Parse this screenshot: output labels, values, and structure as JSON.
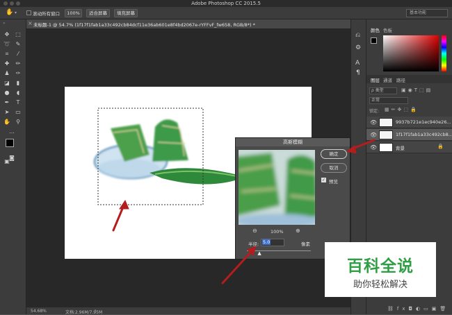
{
  "window": {
    "title": "Adobe Photoshop CC 2015.5"
  },
  "options_bar": {
    "scroll_all": "滚动所有窗口",
    "zoom_100": "100%",
    "fit_screen": "适合屏幕",
    "fill_screen": "填充屏幕",
    "workspace": "基本功能"
  },
  "document": {
    "tab_title": "未标题-1 @ 54.7% (1f17f1fab1a33c492cb84dcf11e36ab601e8f4bd2067e-rYFFvF_fw658, RGB/8*) *",
    "zoom": "54.68%",
    "doc_info": "文档:2.96M/7.95M"
  },
  "panels": {
    "color_tab": "颜色",
    "swatches_tab": "色板",
    "layers_tab": "图层",
    "channels_tab": "通道",
    "paths_tab": "路径",
    "kind_filter": "ρ 类型",
    "blend_mode": "正常",
    "lock_label": "锁定:",
    "layers": [
      {
        "name": "9937b721e1ec940e26...",
        "visible": true
      },
      {
        "name": "1f17f1fab1a33c492cb8...",
        "visible": true
      },
      {
        "name": "背景",
        "visible": true
      }
    ]
  },
  "dialog": {
    "title": "高斯模糊",
    "ok": "确定",
    "cancel": "取消",
    "preview_label": "预览",
    "preview_checked": true,
    "zoom": "100%",
    "radius_label": "半径:",
    "radius_value": "5.0",
    "unit": "像素",
    "radius_slider_fraction": 0.05
  },
  "watermark": {
    "line1": "百科全说",
    "line2": "助你轻松解决"
  },
  "colors": {
    "accent_arrow": "#b31d1d",
    "leaf_green": "#3d9a48",
    "watermark_green": "#2f9e45"
  }
}
